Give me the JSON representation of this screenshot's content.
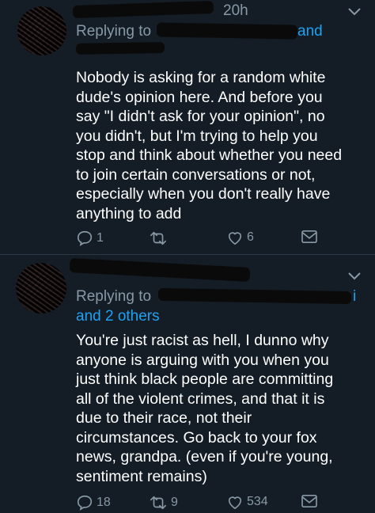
{
  "tweets": [
    {
      "time": "20h",
      "reply_prefix": "Replying to",
      "reply_suffix": "and",
      "others": "",
      "text": "Nobody is asking for a random white\ndude's opinion here. And before you\nsay \"I didn't ask for your opinion\", no\nyou didn't, but I'm trying to help you\nstop and think about whether you need\nto join certain conversations or not,\nespecially when you don't really have\nanything to add",
      "replies": "1",
      "retweets": "",
      "likes": "6"
    },
    {
      "time": "",
      "reply_prefix": "Replying to",
      "reply_suffix": "i",
      "others": "and 2 others",
      "text": "You're just racist as hell, I dunno why\nanyone is arguing with you when you\njust think black people are committing\nall of the violent crimes, and that it is\ndue to their race, not their\ncircumstances. Go back to your fox\nnews, grandpa. (even if you're young,\nsentiment remains)",
      "replies": "18",
      "retweets": "9",
      "likes": "534"
    }
  ],
  "colors": {
    "background": "#141d26",
    "secondary_text": "#8899a6",
    "link": "#1da1f2",
    "divider": "#2a3744"
  },
  "icons": {
    "reply": "reply-icon",
    "retweet": "retweet-icon",
    "like": "heart-icon",
    "dm": "envelope-icon",
    "more": "chevron-down-icon"
  }
}
